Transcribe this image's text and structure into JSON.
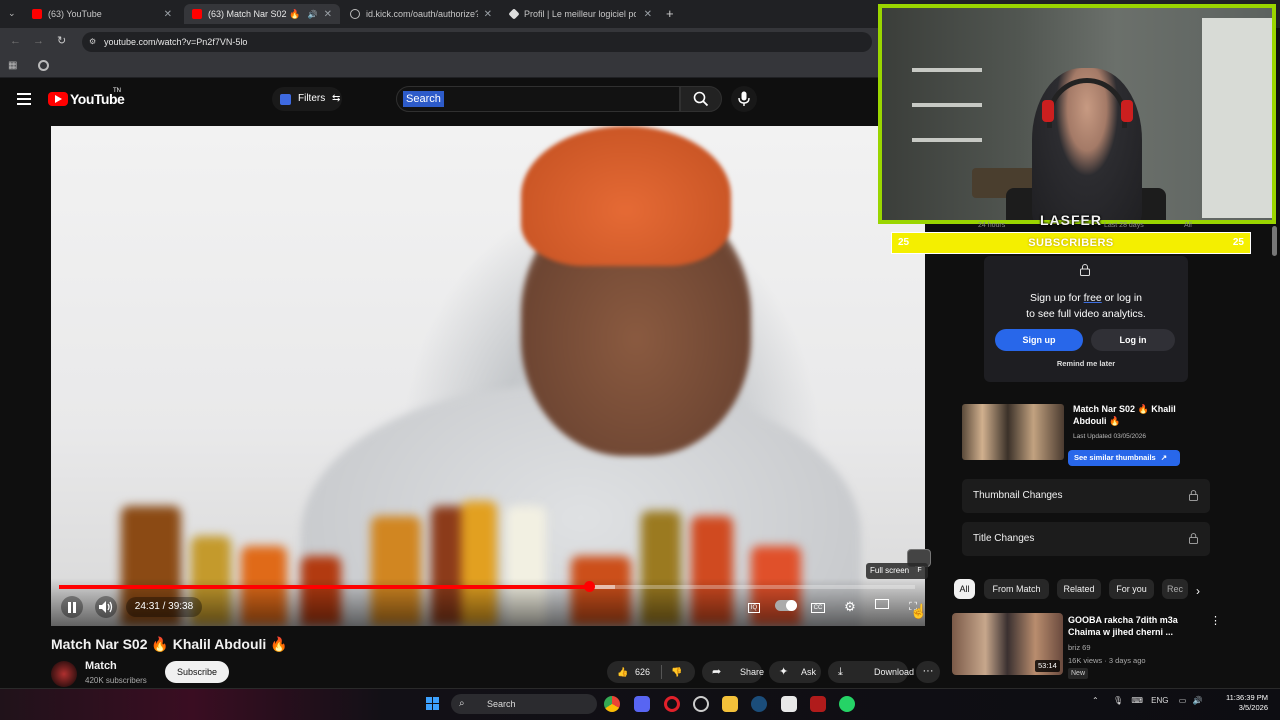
{
  "browser": {
    "tabs": [
      {
        "title": "(63) YouTube",
        "active": false
      },
      {
        "title": "(63) Match Nar S02 🔥 Kh",
        "active": true
      },
      {
        "title": "id.kick.com/oauth/authorize?re",
        "active": false
      },
      {
        "title": "Profil | Le meilleur logiciel pour",
        "active": false
      }
    ],
    "url": "youtube.com/watch?v=Pn2f7VN-5lo",
    "new_tab": "+"
  },
  "youtube": {
    "logo_text": "YouTube",
    "country_code": "TN",
    "filters_label": "Filters",
    "search_placeholder": "Search"
  },
  "player": {
    "current_time": "24:31",
    "duration": "39:38",
    "time_display": "24:31 / 39:38",
    "progress_fraction": 0.619,
    "buffered_fraction": 0.65,
    "fullscreen_tooltip": "Full screen",
    "fullscreen_key": "F"
  },
  "video": {
    "title_prefix": "Match Nar S02",
    "title_name": "Khalil Abdouli",
    "flame": "🔥",
    "channel": "Match",
    "subscribers": "420K subscribers",
    "subscribe_label": "Subscribe",
    "likes": "626",
    "share_label": "Share",
    "ask_label": "Ask",
    "download_label": "Download",
    "more_label": "···"
  },
  "stream_overlay": {
    "streamer_name": "LASFER",
    "subscribers_bar_label": "SUBSCRIBERS",
    "sub_count_left": "25",
    "sub_count_right": "25",
    "tab_24h": "24 hours",
    "tab_28d": "Last 28 days",
    "tab_all": "All",
    "accent_color": "#9ad500"
  },
  "analytics_panel": {
    "signup_line1": "Sign up for free or log in",
    "signup_free_word": "free",
    "signup_line2": "to see full video analytics.",
    "signup_button": "Sign up",
    "login_button": "Log in",
    "remind_later": "Remind me later",
    "video_title": "Match Nar S02 🔥 Khalil Abdouli 🔥",
    "last_updated": "Last Updated 03/05/2026",
    "similar_thumbnails": "See similar thumbnails",
    "thumbnail_changes": "Thumbnail Changes",
    "title_changes": "Title Changes"
  },
  "chips": [
    {
      "label": "All",
      "selected": true
    },
    {
      "label": "From Match",
      "selected": false
    },
    {
      "label": "Related",
      "selected": false
    },
    {
      "label": "For you",
      "selected": false
    },
    {
      "label": "Rec",
      "selected": false
    }
  ],
  "related": {
    "title": "GOOBA rakcha 7dith m3a Chaima w jihed cherni ...",
    "channel": "briz 69",
    "meta": "16K views · 3 days ago",
    "badge": "New",
    "duration": "53:14"
  },
  "taskbar": {
    "search_label": "Search",
    "language": "ENG",
    "time": "11:36:39 PM",
    "date": "3/5/2026"
  }
}
